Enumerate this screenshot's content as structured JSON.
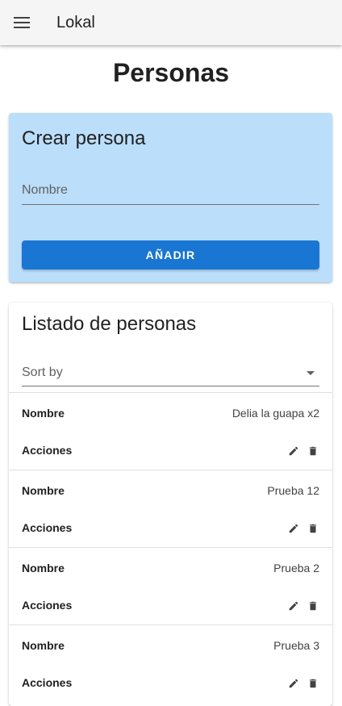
{
  "appbar": {
    "title": "Lokal"
  },
  "page": {
    "title": "Personas"
  },
  "create_card": {
    "title": "Crear persona",
    "name_placeholder": "Nombre",
    "name_value": "",
    "add_label": "AÑADIR"
  },
  "list_card": {
    "title": "Listado de personas",
    "sort_label": "Sort by",
    "rows": [
      {
        "name_label": "Nombre",
        "name_value": "Delia la guapa x2",
        "actions_label": "Acciones"
      },
      {
        "name_label": "Nombre",
        "name_value": "Prueba 12",
        "actions_label": "Acciones"
      },
      {
        "name_label": "Nombre",
        "name_value": "Prueba 2",
        "actions_label": "Acciones"
      },
      {
        "name_label": "Nombre",
        "name_value": "Prueba 3",
        "actions_label": "Acciones"
      }
    ]
  },
  "icons": {
    "menu": "menu-icon",
    "edit": "pencil-icon",
    "delete": "trash-icon",
    "sort_dropdown": "caret-down-icon"
  },
  "colors": {
    "appbar_bg": "#f5f5f5",
    "create_card_bg": "#bbdefb",
    "primary_button": "#1976d2"
  }
}
